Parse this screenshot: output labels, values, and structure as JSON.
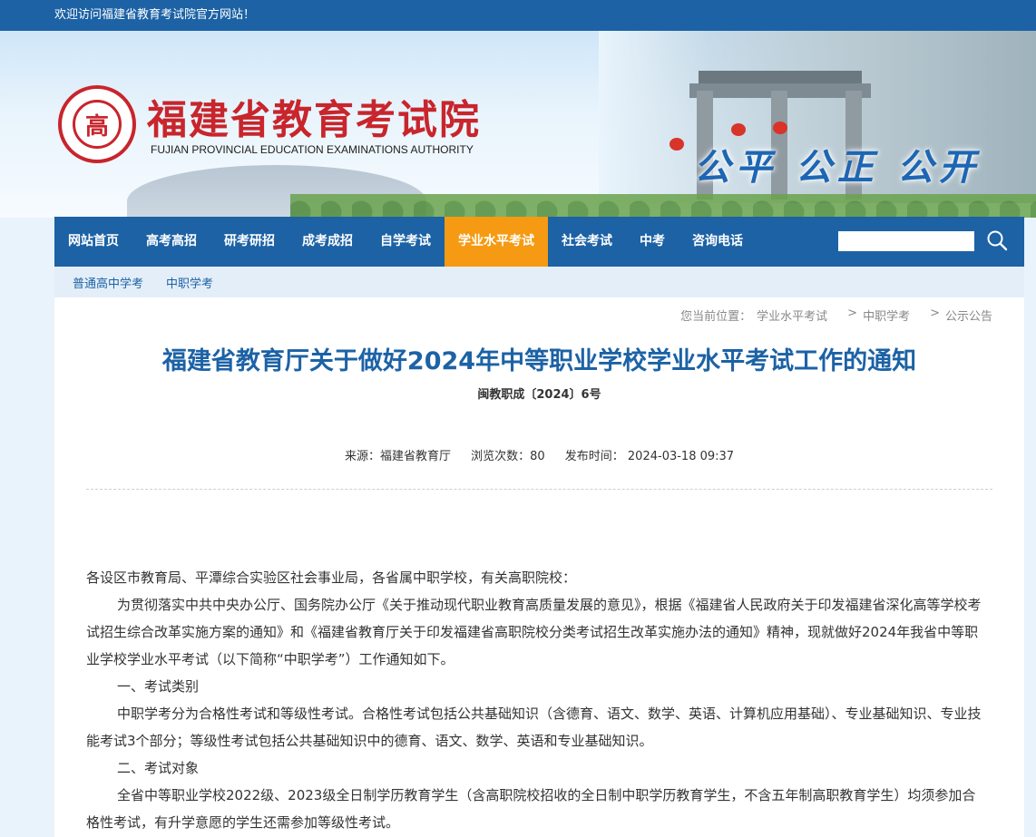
{
  "topbar": {
    "welcome": "欢迎访问福建省教育考试院官方网站！"
  },
  "header": {
    "seal_char": "高",
    "title": "福建省教育考试院",
    "subtitle": "FUJIAN PROVINCIAL EDUCATION EXAMINATIONS AUTHORITY",
    "slogan": "公平  公正  公开"
  },
  "nav": {
    "items": [
      "网站首页",
      "高考高招",
      "研考研招",
      "成考成招",
      "自学考试",
      "学业水平考试",
      "社会考试",
      "中考",
      "咨询电话"
    ],
    "active_index": 5,
    "search_value": ""
  },
  "subnav": {
    "items": [
      "普通高中学考",
      "中职学考"
    ]
  },
  "breadcrumb": {
    "label": "您当前位置：",
    "items": [
      "学业水平考试",
      "中职学考",
      "公示公告"
    ]
  },
  "article": {
    "title": "福建省教育厅关于做好2024年中等职业学校学业水平考试工作的通知",
    "doc_number": "闽教职成〔2024〕6号",
    "source": "来源：福建省教育厅",
    "views": "浏览次数：80",
    "published": "发布时间： 2024-03-18 09:37",
    "paragraphs": [
      "各设区市教育局、平潭综合实验区社会事业局，各省属中职学校，有关高职院校：",
      "为贯彻落实中共中央办公厅、国务院办公厅《关于推动现代职业教育高质量发展的意见》，根据《福建省人民政府关于印发福建省深化高等学校考试招生综合改革实施方案的通知》和《福建省教育厅关于印发福建省高职院校分类考试招生改革实施办法的通知》精神，现就做好2024年我省中等职业学校学业水平考试（以下简称“中职学考”）工作通知如下。",
      "一、考试类别",
      "中职学考分为合格性考试和等级性考试。合格性考试包括公共基础知识（含德育、语文、数学、英语、计算机应用基础）、专业基础知识、专业技能考试3个部分；等级性考试包括公共基础知识中的德育、语文、数学、英语和专业基础知识。",
      "二、考试对象",
      "全省中等职业学校2022级、2023级全日制学历教育学生（含高职院校招收的全日制中职学历教育学生，不含五年制高职教育学生）均须参加合格性考试，有升学意愿的学生还需参加等级性考试。"
    ]
  },
  "colors": {
    "primary": "#1c62a5",
    "accent": "#f59a12",
    "brand_red": "#c8252c"
  },
  "icons": {
    "search": "search-icon"
  }
}
